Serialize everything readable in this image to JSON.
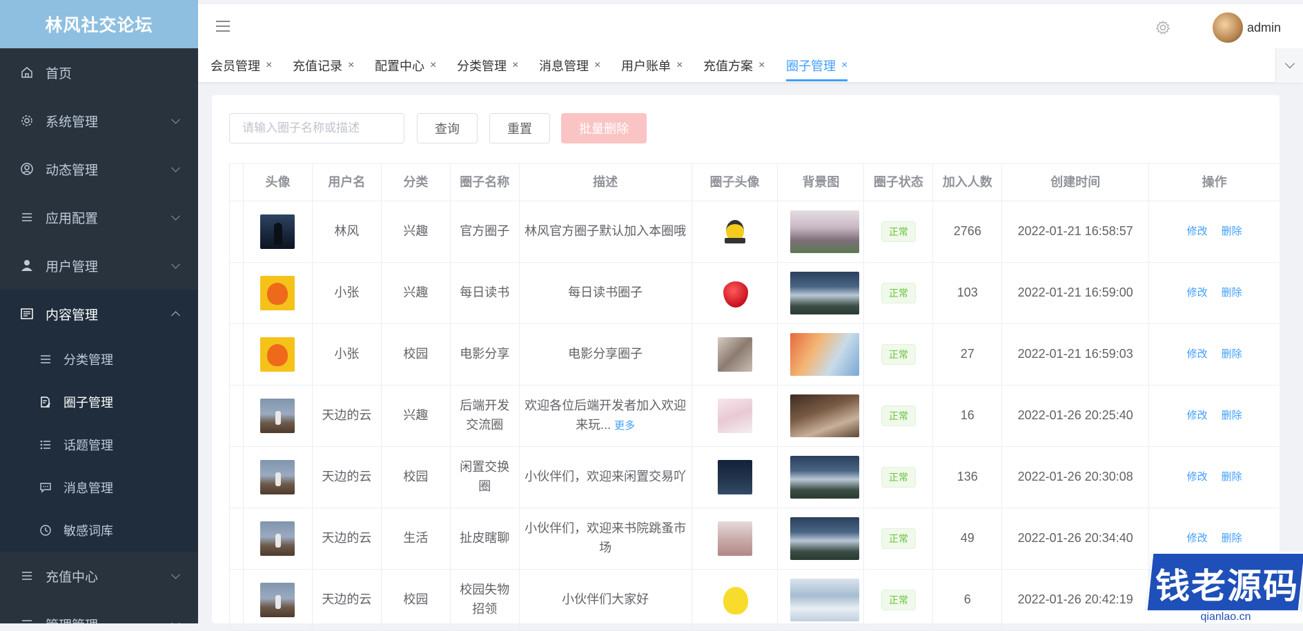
{
  "app": {
    "title": "林风社交论坛"
  },
  "sidebar": {
    "items": [
      {
        "label": "首页",
        "icon": "home-icon"
      },
      {
        "label": "系统管理",
        "icon": "gear-icon"
      },
      {
        "label": "动态管理",
        "icon": "user-circle-icon"
      },
      {
        "label": "应用配置",
        "icon": "list-icon"
      },
      {
        "label": "用户管理",
        "icon": "person-icon"
      },
      {
        "label": "内容管理",
        "icon": "content-icon",
        "expanded": true
      }
    ],
    "subitems": [
      {
        "label": "分类管理",
        "icon": "list-icon"
      },
      {
        "label": "圈子管理",
        "icon": "document-edit-icon",
        "active": true
      },
      {
        "label": "话题管理",
        "icon": "list-bullets-icon"
      },
      {
        "label": "消息管理",
        "icon": "message-icon"
      },
      {
        "label": "敏感词库",
        "icon": "clock-icon"
      }
    ],
    "after": [
      {
        "label": "充值中心",
        "icon": "list-icon"
      },
      {
        "label": "管理管理",
        "icon": "list-icon"
      }
    ]
  },
  "header": {
    "username": "admin"
  },
  "tabs": [
    {
      "label": "会员管理"
    },
    {
      "label": "充值记录"
    },
    {
      "label": "配置中心"
    },
    {
      "label": "分类管理"
    },
    {
      "label": "消息管理"
    },
    {
      "label": "用户账单"
    },
    {
      "label": "充值方案"
    },
    {
      "label": "圈子管理",
      "active": true
    }
  ],
  "search": {
    "placeholder": "请输入圈子名称或描述",
    "query_label": "查询",
    "reset_label": "重置",
    "batch_delete_label": "批量删除"
  },
  "table": {
    "columns": [
      "头像",
      "用户名",
      "分类",
      "圈子名称",
      "描述",
      "圈子头像",
      "背景图",
      "圈子状态",
      "加入人数",
      "创建时间",
      "操作"
    ],
    "rows": [
      {
        "username": "林风",
        "category": "兴趣",
        "name": "官方圈子",
        "desc": "林风官方圈子默认加入本圈哦",
        "more": "",
        "status": "正常",
        "members": "2766",
        "created": "2022-01-21 16:58:57"
      },
      {
        "username": "小张",
        "category": "兴趣",
        "name": "每日读书",
        "desc": "每日读书圈子",
        "more": "",
        "status": "正常",
        "members": "103",
        "created": "2022-01-21 16:59:00"
      },
      {
        "username": "小张",
        "category": "校园",
        "name": "电影分享",
        "desc": "电影分享圈子",
        "more": "",
        "status": "正常",
        "members": "27",
        "created": "2022-01-21 16:59:03"
      },
      {
        "username": "天边的云",
        "category": "兴趣",
        "name": "后端开发交流圈",
        "desc": "欢迎各位后端开发者加入欢迎来玩...",
        "more": "更多",
        "status": "正常",
        "members": "16",
        "created": "2022-01-26 20:25:40"
      },
      {
        "username": "天边的云",
        "category": "校园",
        "name": "闲置交换圈",
        "desc": "小伙伴们，欢迎来闲置交易吖",
        "more": "",
        "status": "正常",
        "members": "136",
        "created": "2022-01-26 20:30:08"
      },
      {
        "username": "天边的云",
        "category": "生活",
        "name": "扯皮瞎聊",
        "desc": "小伙伴们，欢迎来书院跳蚤市场",
        "more": "",
        "status": "正常",
        "members": "49",
        "created": "2022-01-26 20:34:40"
      },
      {
        "username": "天边的云",
        "category": "校园",
        "name": "校园失物招领",
        "desc": "小伙伴们大家好",
        "more": "",
        "status": "正常",
        "members": "6",
        "created": "2022-01-26 20:42:19"
      }
    ],
    "edit_label": "修改",
    "delete_label": "删除"
  },
  "watermark": {
    "text": "钱老源码",
    "url": "qianlao.cn"
  },
  "colors": {
    "accent": "#409eff",
    "sidebar_bg": "#28333e",
    "logo_bg": "#8fbfe0",
    "success": "#67c23a",
    "danger_light": "#fbc4c4"
  }
}
